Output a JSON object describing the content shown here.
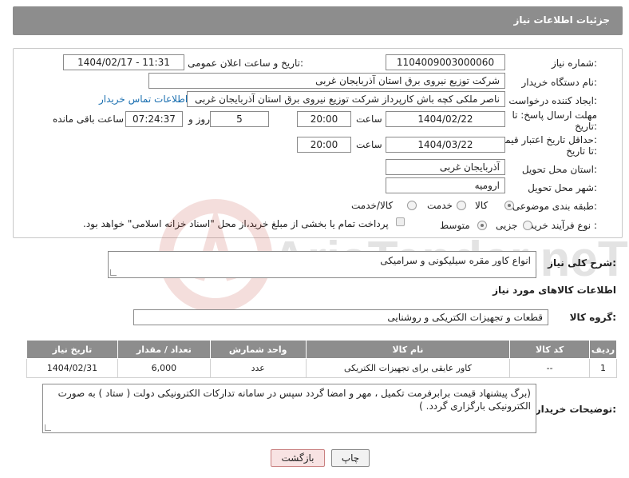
{
  "header": {
    "title": "جزئیات اطلاعات نیاز"
  },
  "form": {
    "need_number_label": "شماره نیاز:",
    "need_number": "1104009003000060",
    "announce_label": "تاریخ و ساعت اعلان عمومی:",
    "announce_value": "1404/02/17 - 11:31",
    "buyer_org_label": "نام دستگاه خریدار:",
    "buyer_org": "شرکت توزیع نیروی برق استان آذربایجان غربی",
    "requester_label": "ایجاد کننده درخواست:",
    "requester": "ناصر ملکی کچه باش کارپرداز شرکت توزیع نیروی برق استان آذربایجان غربی",
    "contact_link": "اطلاعات تماس خریدار",
    "deadline_label_1": "مهلت ارسال پاسخ: تا",
    "deadline_label_2": "تاریخ:",
    "deadline_date": "1404/02/22",
    "time_label": "ساعت",
    "deadline_time": "20:00",
    "days": "5",
    "days_label": "روز و",
    "remaining_time": "07:24:37",
    "remaining_label": "ساعت باقی مانده",
    "validity_label_1": "حداقل تاریخ اعتبار قیمت:",
    "validity_label_2": "تا تاریخ:",
    "validity_date": "1404/03/22",
    "validity_time_label": "ساعت",
    "validity_time": "20:00",
    "province_label": "استان محل تحویل:",
    "province": "آذربایجان غربی",
    "city_label": "شهر محل تحویل:",
    "city": "ارومیه",
    "category_label": "طبقه بندی موضوعی:",
    "category_options": [
      "کالا",
      "خدمت",
      "کالا/خدمت"
    ],
    "process_label": "نوع فرآیند خرید :",
    "process_options": [
      "جزیی",
      "متوسط"
    ],
    "payment_note": "پرداخت تمام یا بخشی از مبلغ خرید،از محل \"اسناد خزانه اسلامی\" خواهد بود."
  },
  "description": {
    "label": "شرح کلی نیاز:",
    "value": "انواع کاور مقره سیلیکونی و سرامیکی"
  },
  "goods": {
    "section_title": "اطلاعات کالاهای مورد نیاز",
    "group_label": "گروه کالا:",
    "group_value": "قطعات و تجهیزات الکتریکی و روشنایی",
    "columns": [
      "ردیف",
      "کد کالا",
      "نام کالا",
      "واحد شمارش",
      "تعداد / مقدار",
      "تاریخ نیاز"
    ],
    "rows": [
      [
        "1",
        "--",
        "کاور عایقی برای تجهیزات الکتریکی",
        "عدد",
        "6,000",
        "1404/02/31"
      ]
    ]
  },
  "buyer_notes": {
    "label": "توضیحات خریدار:",
    "value": "(برگ پیشنهاد قیمت برابرفرمت تکمیل ، مهر و امضا گردد سپس در سامانه تدارکات الکترونیکی دولت ( ستاد ) به صورت الکترونیکی  بارگزاری گردد. )"
  },
  "buttons": {
    "print": "چاپ",
    "back": "بازگشت"
  },
  "watermark": {
    "text": "AriaTender.neT"
  },
  "colors": {
    "header_bg": "#8d8d8d",
    "link": "#1a6fb0",
    "back_button": "#f8e3e3"
  }
}
